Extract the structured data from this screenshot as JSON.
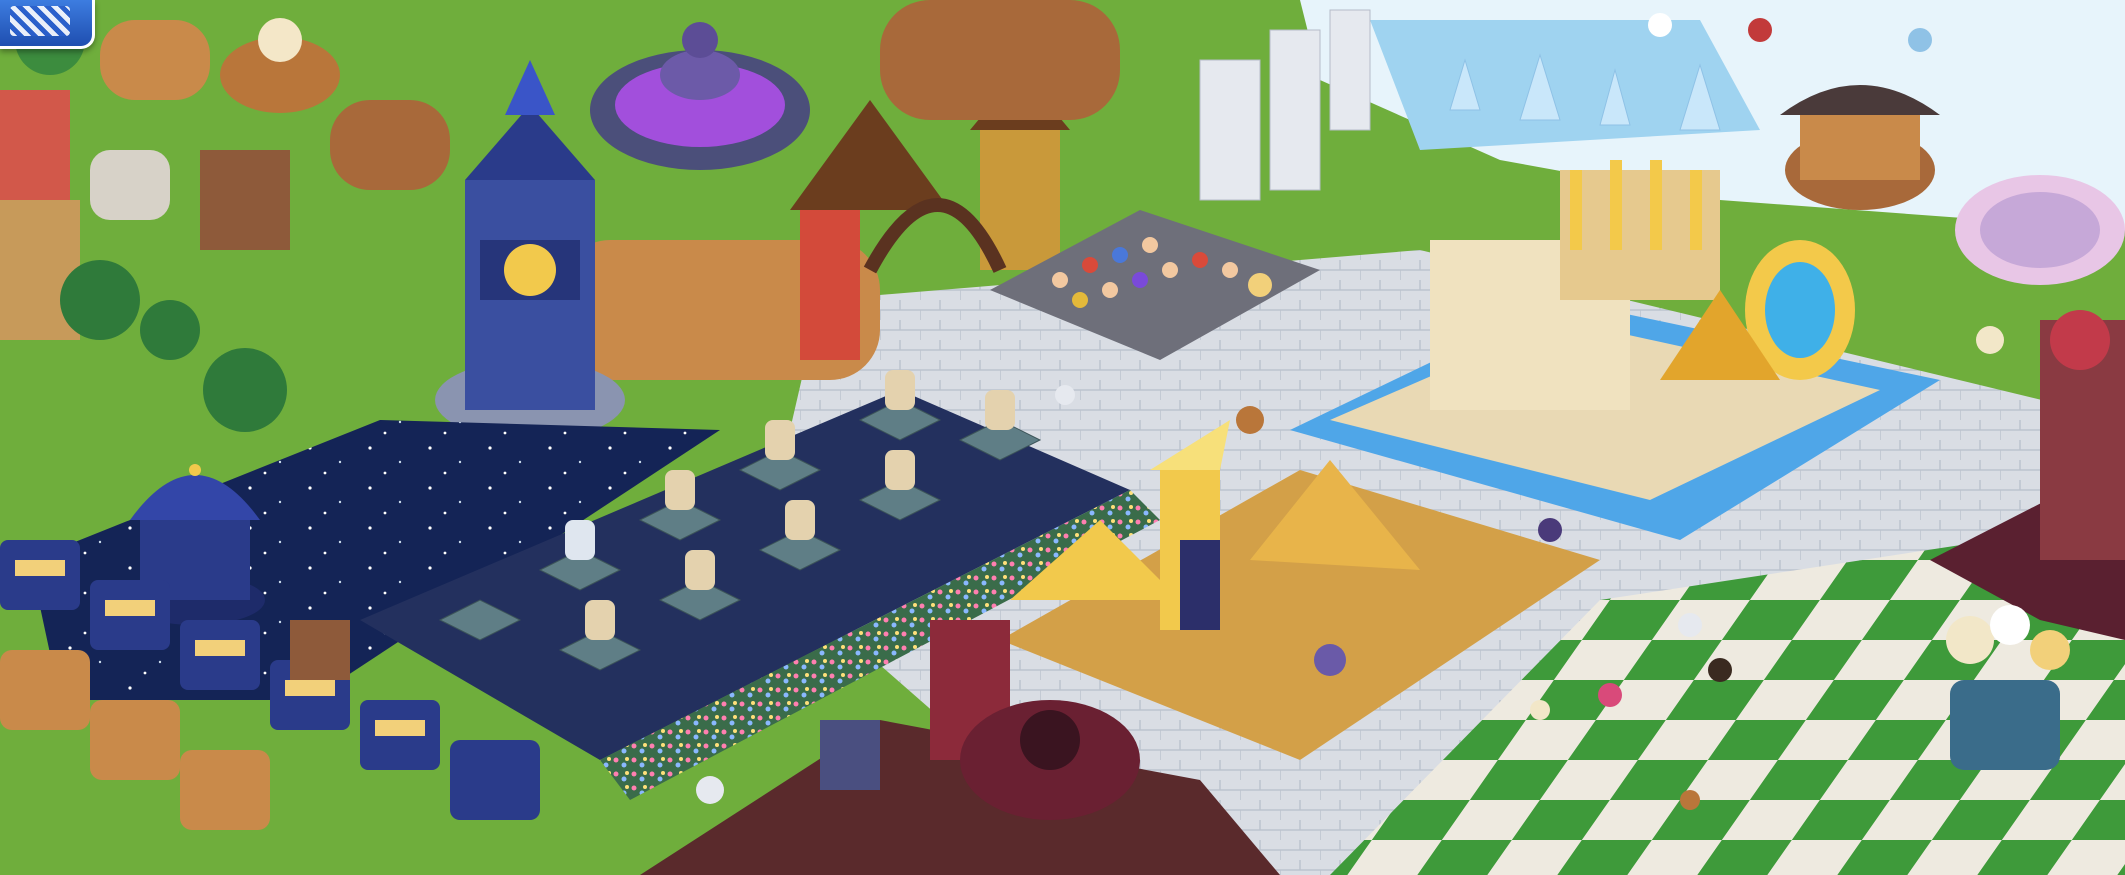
{
  "scene": {
    "sky_color": "#7cbf4a",
    "stone_color": "#d8dde6",
    "checker_green": "#3e9a3a",
    "checker_white": "#eeeae0",
    "water_color": "#4fa6e8",
    "night_pool_color": "#142456",
    "statue_base_color": "#5f7e86",
    "gold_color": "#e2a52c",
    "brown_color": "#b9763a",
    "snow_color": "#e7f4fb",
    "purple_color": "#a24fdc",
    "dark_red_color": "#6a2032"
  },
  "icons": {
    "corner_button": "menu-grip-icon"
  }
}
